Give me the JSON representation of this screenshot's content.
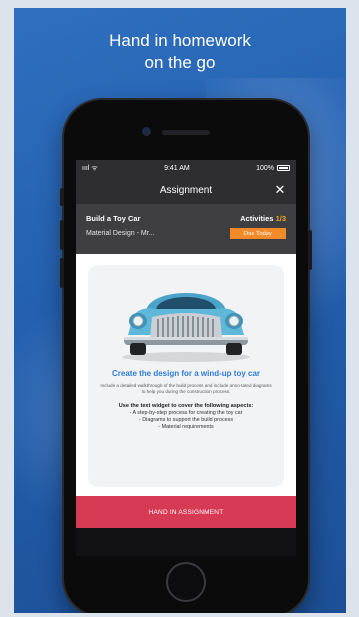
{
  "headline": {
    "line1": "Hand in homework",
    "line2": "on the go"
  },
  "status_bar": {
    "signal": "ıııl ᯤ",
    "time": "9:41 AM",
    "battery": "100%"
  },
  "nav": {
    "title": "Assignment",
    "close_icon": "✕"
  },
  "assignment": {
    "title": "Build a Toy Car",
    "activities_label": "Activities",
    "activities_count": "1/3",
    "material": "Material Design - Mr...",
    "due": "Due Today"
  },
  "card": {
    "heading": "Create the design for a wind-up toy car",
    "description": "Include a detailed walkthrough of the build process and include anno-tated diagrams to help you during the construction process.",
    "widget_heading": "Use the text widget to cover the following aspects:",
    "aspects": [
      "- A step-by-step process for creating the toy car",
      "- Diagrams to support the build process",
      "- Material requirements"
    ]
  },
  "action": {
    "hand_in_label": "HAND IN ASSIGNMENT"
  },
  "colors": {
    "background_blue": "#235fae",
    "header_dark": "#2e2e30",
    "info_bar": "#3f3f42",
    "accent_orange": "#f28a2a",
    "title_blue": "#2f7bd8",
    "hand_in_red": "#d63a55"
  },
  "icons": {
    "close": "close-icon",
    "signal": "signal-icon",
    "battery": "battery-icon",
    "car": "car-illustration"
  }
}
